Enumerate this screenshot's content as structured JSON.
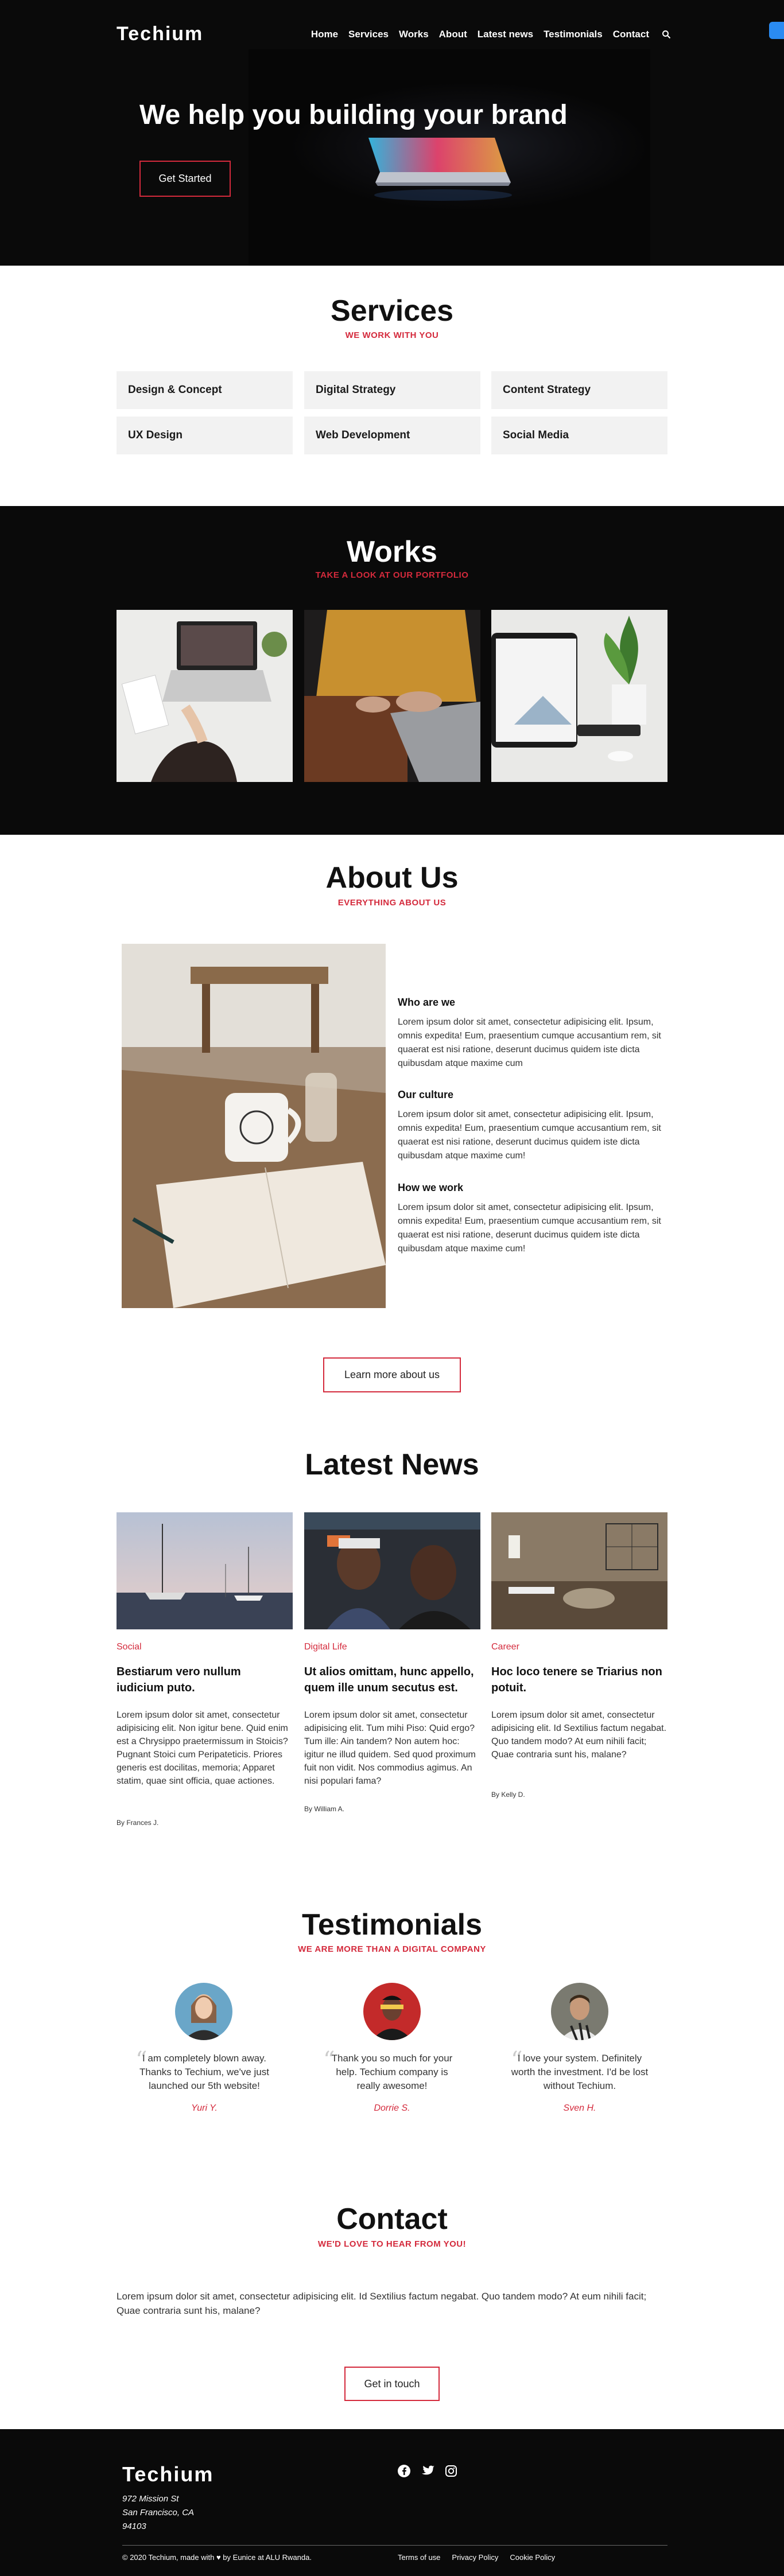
{
  "nav": {
    "logo": "Techium",
    "items": [
      "Home",
      "Services",
      "Works",
      "About",
      "Latest news",
      "Testimonials",
      "Contact"
    ],
    "search_icon": "search-icon"
  },
  "hero": {
    "title": "We help you building your brand",
    "button": "Get Started"
  },
  "services": {
    "title": "Services",
    "subtitle": "WE WORK WITH YOU",
    "items": [
      "Design & Concept",
      "Digital Strategy",
      "Content Strategy",
      "UX Design",
      "Web Development",
      "Social Media"
    ]
  },
  "works": {
    "title": "Works",
    "subtitle": "TAKE A LOOK AT OUR PORTFOLIO"
  },
  "about": {
    "title": "About Us",
    "subtitle": "EVERYTHING ABOUT US",
    "blocks": [
      {
        "heading": "Who are we",
        "text": "Lorem ipsum dolor sit amet, consectetur adipisicing elit. Ipsum, omnis expedita! Eum, praesentium cumque accusantium rem, sit quaerat est nisi ratione, deserunt ducimus quidem iste dicta quibusdam atque maxime cum"
      },
      {
        "heading": "Our culture",
        "text": "Lorem ipsum dolor sit amet, consectetur adipisicing elit. Ipsum, omnis expedita! Eum, praesentium cumque accusantium rem, sit quaerat est nisi ratione, deserunt ducimus quidem iste dicta quibusdam atque maxime cum!"
      },
      {
        "heading": "How we work",
        "text": "Lorem ipsum dolor sit amet, consectetur adipisicing elit. Ipsum, omnis expedita! Eum, praesentium cumque accusantium rem, sit quaerat est nisi ratione, deserunt ducimus quidem iste dicta quibusdam atque maxime cum!"
      }
    ],
    "button": "Learn more about us"
  },
  "news": {
    "title": "Latest News",
    "items": [
      {
        "category": "Social",
        "title": "Bestiarum vero nullum iudicium puto.",
        "body": "Lorem ipsum dolor sit amet, consectetur adipisicing elit. Non igitur bene. Quid enim est a Chrysippo praetermissum in Stoicis? Pugnant Stoici cum Peripateticis. Priores generis est docilitas, memoria; Apparet statim, quae sint officia, quae actiones.",
        "author": "By Frances J."
      },
      {
        "category": "Digital Life",
        "title": "Ut alios omittam, hunc appello, quem ille unum secutus est.",
        "body": "Lorem ipsum dolor sit amet, consectetur adipisicing elit. Tum mihi Piso: Quid ergo? Tum ille: Ain tandem? Non autem hoc: igitur ne illud quidem. Sed quod proximum fuit non vidit. Nos commodius agimus. An nisi populari fama?",
        "author": "By William A."
      },
      {
        "category": "Career",
        "title": "Hoc loco tenere se Triarius non potuit.",
        "body": "Lorem ipsum dolor sit amet, consectetur adipisicing elit. Id Sextilius factum negabat. Quo tandem modo? At eum nihili facit; Quae contraria sunt his, malane?",
        "author": "By Kelly D."
      }
    ]
  },
  "testimonials": {
    "title": "Testimonials",
    "subtitle": "WE ARE MORE THAN A DIGITAL COMPANY",
    "items": [
      {
        "quote": "I am completely blown away. Thanks to Techium, we've just launched our 5th website!",
        "name": "Yuri Y."
      },
      {
        "quote": "Thank you so much for your help. Techium company is really awesome!",
        "name": "Dorrie S."
      },
      {
        "quote": "I love your system. Definitely worth the investment. I'd be lost without Techium.",
        "name": "Sven H."
      }
    ]
  },
  "contact": {
    "title": "Contact",
    "subtitle": "WE'D LOVE TO HEAR FROM YOU!",
    "text": "Lorem ipsum dolor sit amet, consectetur adipisicing elit. Id Sextilius factum negabat. Quo tandem modo? At eum nihili facit; Quae contraria sunt his, malane?",
    "button": "Get in touch"
  },
  "footer": {
    "logo": "Techium",
    "address": [
      "972 Mission St",
      "San Francisco, CA",
      "94103"
    ],
    "copyright": "© 2020 Techium, made with ♥ by Eunice at ALU Rwanda.",
    "links": [
      "Terms of use",
      "Privacy Policy",
      "Cookie Policy"
    ],
    "social_icons": [
      "facebook-icon",
      "twitter-icon",
      "instagram-icon"
    ]
  },
  "colors": {
    "accent": "#d42a3c",
    "dark": "#0a0a0a",
    "card": "#f2f2f2"
  }
}
